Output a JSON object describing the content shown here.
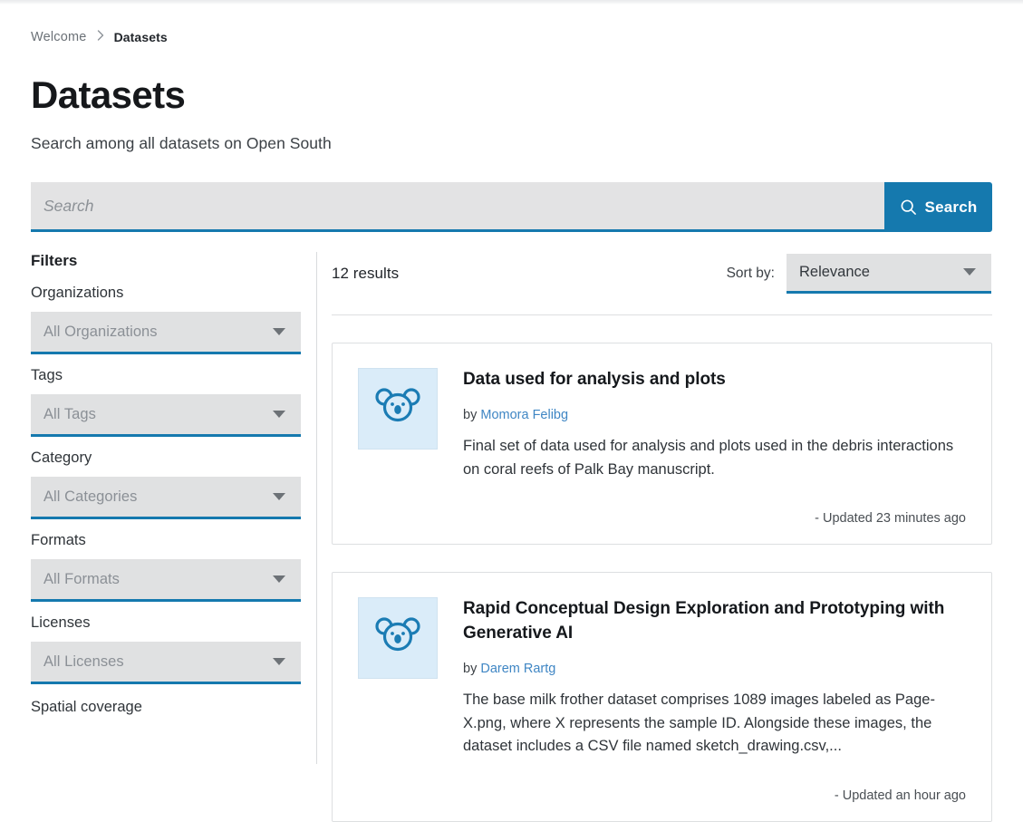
{
  "breadcrumb": {
    "home_label": "Welcome",
    "separator": "›",
    "current_label": "Datasets"
  },
  "header": {
    "title": "Datasets",
    "subtitle": "Search among all datasets on Open South"
  },
  "search": {
    "placeholder": "Search",
    "value": "",
    "button_label": "Search",
    "icon": "search-icon",
    "accent_color": "#1579ae"
  },
  "sidebar": {
    "heading": "Filters",
    "filters": [
      {
        "label": "Organizations",
        "value": "All Organizations",
        "name": "organizations"
      },
      {
        "label": "Tags",
        "value": "All Tags",
        "name": "tags"
      },
      {
        "label": "Category",
        "value": "All Categories",
        "name": "category"
      },
      {
        "label": "Formats",
        "value": "All Formats",
        "name": "formats"
      },
      {
        "label": "Licenses",
        "value": "All Licenses",
        "name": "licenses"
      }
    ],
    "trailing_label": "Spatial coverage"
  },
  "results": {
    "count_label": "12 results",
    "sort_label": "Sort by:",
    "sort_value": "Relevance",
    "sort_options": [
      "Relevance"
    ],
    "items": [
      {
        "title": "Data used for analysis and plots",
        "by_prefix": "by",
        "author": "Momora Felibg",
        "description": "Final set of data used for analysis and plots used in the debris interactions on coral reefs of Palk Bay manuscript.",
        "updated": "- Updated 23 minutes ago",
        "thumb_icon": "koala-icon"
      },
      {
        "title": "Rapid Conceptual Design Exploration and Prototyping with Generative AI",
        "by_prefix": "by",
        "author": "Darem Rartg",
        "description": "The base milk frother dataset comprises 1089 images labeled as Page-X.png, where X represents the sample ID. Alongside these images, the dataset includes a CSV file named sketch_drawing.csv,...",
        "updated": "- Updated an hour ago",
        "thumb_icon": "koala-icon"
      }
    ]
  }
}
